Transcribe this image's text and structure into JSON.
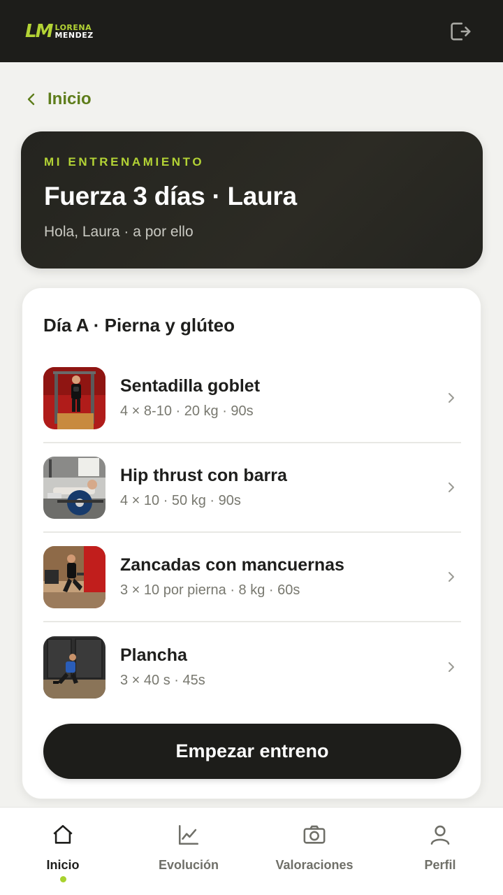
{
  "header": {
    "logo_mark": "LM",
    "logo_line1": "LORENA",
    "logo_line2": "MENDEZ",
    "logout_icon": "logout-icon"
  },
  "nav": {
    "back_label": "Inicio"
  },
  "hero": {
    "kicker": "MI ENTRENAMIENTO",
    "title": "Fuerza 3 días · Laura",
    "subtitle": "Hola, Laura · a por ello"
  },
  "workout": {
    "day_title": "Día A · Pierna y glúteo",
    "exercises": [
      {
        "name": "Sentadilla goblet",
        "detail": "4 × 8-10 · 20 kg · 90s"
      },
      {
        "name": "Hip thrust con barra",
        "detail": "4 × 10 · 50 kg · 90s"
      },
      {
        "name": "Zancadas con mancuernas",
        "detail": "3 × 10 por pierna · 8 kg · 60s"
      },
      {
        "name": "Plancha",
        "detail": "3 × 40 s · 45s"
      }
    ],
    "start_label": "Empezar entreno"
  },
  "tabs": [
    {
      "label": "Inicio",
      "icon": "home-icon",
      "active": true
    },
    {
      "label": "Evolución",
      "icon": "chart-icon",
      "active": false
    },
    {
      "label": "Valoraciones",
      "icon": "camera-icon",
      "active": false
    },
    {
      "label": "Perfil",
      "icon": "user-icon",
      "active": false
    }
  ],
  "colors": {
    "accent": "#b3d335",
    "dark": "#1d1d1a",
    "back_link": "#5e7d1b",
    "background": "#f2f2ef"
  }
}
